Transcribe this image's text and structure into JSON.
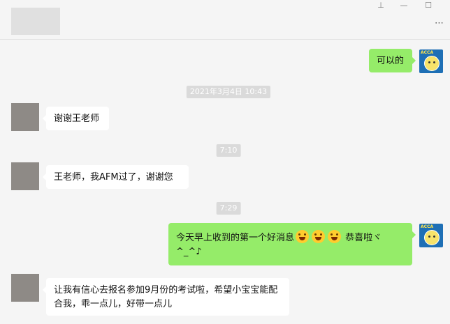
{
  "window": {
    "pin_icon": "pin-icon",
    "minimize_icon": "minimize-icon",
    "maximize_icon": "maximize-icon",
    "more_icon": "more-icon"
  },
  "messages": {
    "m1": {
      "side": "right",
      "text": "可以的"
    },
    "ts1": {
      "text": "2021年3月4日 10:43"
    },
    "m2": {
      "side": "left",
      "text": "谢谢王老师"
    },
    "ts2": {
      "text": "7:10"
    },
    "m3": {
      "side": "left",
      "text": "王老师，我AFM过了，谢谢您"
    },
    "ts3": {
      "text": "7:29"
    },
    "m4": {
      "side": "right",
      "text_before": "今天早上收到的第一个好消息",
      "emoji_icon": "grinning-face-emoji",
      "text_after": "恭喜啦ヾ^_^♪"
    },
    "m5": {
      "side": "left",
      "text": "让我有信心去报名参加9月份的考试啦，希望小宝宝能配合我，乖一点儿，好带一点儿"
    }
  },
  "avatars": {
    "self_label": "ACCA"
  },
  "colors": {
    "background": "#f5f5f5",
    "self_bubble": "#95ec69",
    "other_bubble": "#ffffff",
    "timestamp_bg": "#dadada"
  }
}
